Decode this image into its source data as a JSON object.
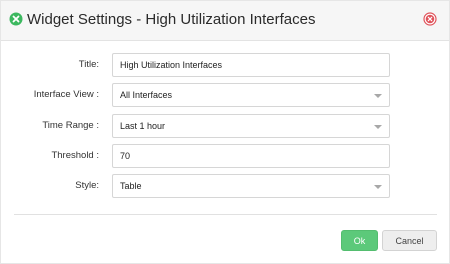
{
  "dialog": {
    "title": "Widget Settings - High Utilization Interfaces",
    "icon": "widget-settings-icon",
    "close_icon": "close-icon",
    "colors": {
      "accent": "#3cb85f",
      "close": "#e0535b",
      "ok_button": "#5cc97a"
    }
  },
  "form": {
    "title": {
      "label": "Title:",
      "value": "High Utilization Interfaces"
    },
    "interface_view": {
      "label": "Interface View :",
      "value": "All Interfaces"
    },
    "time_range": {
      "label": "Time Range :",
      "value": "Last 1 hour"
    },
    "threshold": {
      "label": "Threshold :",
      "value": "70"
    },
    "style": {
      "label": "Style:",
      "value": "Table"
    }
  },
  "buttons": {
    "ok_label": "Ok",
    "cancel_label": "Cancel"
  }
}
